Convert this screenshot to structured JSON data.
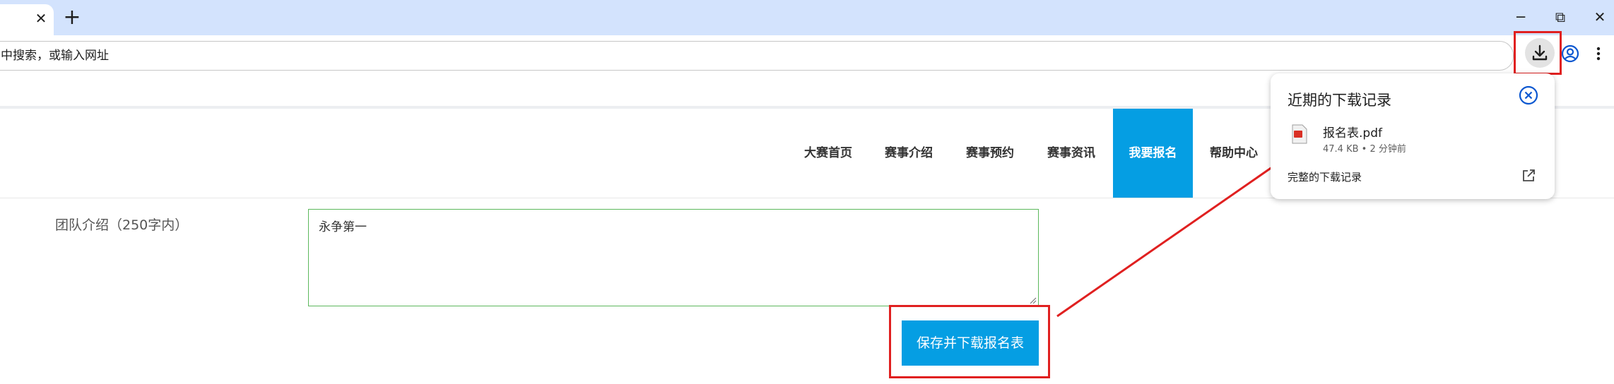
{
  "browser": {
    "tab_close": "✕",
    "new_tab": "+",
    "minimize": "─",
    "restore": "⧉",
    "close": "✕",
    "omnibox_text": "中搜索，或输入网址"
  },
  "site_nav": {
    "items": [
      {
        "label": "大赛首页"
      },
      {
        "label": "赛事介绍"
      },
      {
        "label": "赛事预约"
      },
      {
        "label": "赛事资讯"
      },
      {
        "label": "我要报名",
        "active": true
      },
      {
        "label": "帮助中心"
      }
    ],
    "active_color": "#059ee3"
  },
  "form": {
    "team_intro_label": "团队介绍（250字内）",
    "team_intro_value": "永争第一",
    "save_button": "保存并下载报名表"
  },
  "downloads": {
    "title": "近期的下载记录",
    "file_name": "报名表.pdf",
    "file_meta": "47.4 KB • 2 分钟前",
    "full_history": "完整的下载记录"
  },
  "colors": {
    "annotation_red": "#e02020",
    "accent_blue": "#059ee3",
    "tabstrip": "#d3e3fd"
  }
}
